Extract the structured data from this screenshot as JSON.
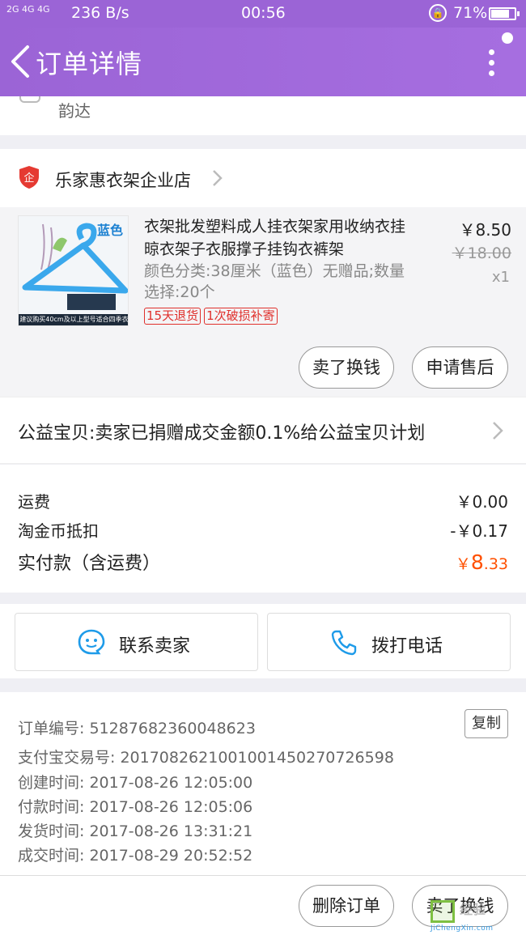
{
  "status_bar": {
    "signal": "2G 4G 4G",
    "net_speed": "236 B/s",
    "time": "00:56",
    "battery": "71%"
  },
  "header": {
    "title": "订单详情"
  },
  "logistics": {
    "carrier": "韵达"
  },
  "store": {
    "name": "乐家惠衣架企业店"
  },
  "item": {
    "image_tag": "蓝色",
    "image_band": "建议购买40cm及以上型号适合四季衣物",
    "title": "衣架批发塑料成人挂衣架家用收纳衣挂晾衣架子衣服撑子挂钩衣裤架",
    "sku": "颜色分类:38厘米（蓝色）无赠品;数量选择:20个",
    "badges": [
      "15天退货",
      "1次破损补寄"
    ],
    "price": "￥8.50",
    "original_price": "￥18.00",
    "quantity": "x1",
    "buttons": {
      "sell": "卖了换钱",
      "after_sale": "申请售后"
    }
  },
  "charity": {
    "text": "公益宝贝:卖家已捐赠成交金额0.1%给公益宝贝计划"
  },
  "cost": {
    "shipping_label": "运费",
    "shipping_value": "￥0.00",
    "coin_label": "淘金币抵扣",
    "coin_value": "-￥0.17",
    "total_label": "实付款（含运费）",
    "total_currency": "￥",
    "total_int": "8",
    "total_dec": ".33"
  },
  "contact": {
    "seller_label": "联系卖家",
    "phone_label": "拨打电话"
  },
  "order_info": {
    "order_no": "订单编号: 51287682360048623",
    "copy_label": "复制",
    "alipay_no": "支付宝交易号: 2017082621001001450270726598",
    "created": "创建时间: 2017-08-26 12:05:00",
    "paid": "付款时间: 2017-08-26 12:05:06",
    "shipped": "发货时间: 2017-08-26 13:31:21",
    "completed": "成交时间: 2017-08-29 20:52:52"
  },
  "bottom_actions": {
    "delete": "删除订单",
    "sell": "卖了换钱"
  },
  "watermark": {
    "text": "经验",
    "site": "JiChengXin.com"
  },
  "colors": {
    "header": "#9b64d6",
    "price_accent": "#ff5000",
    "badge": "#e0302c",
    "contact_icon": "#1e9be9"
  }
}
